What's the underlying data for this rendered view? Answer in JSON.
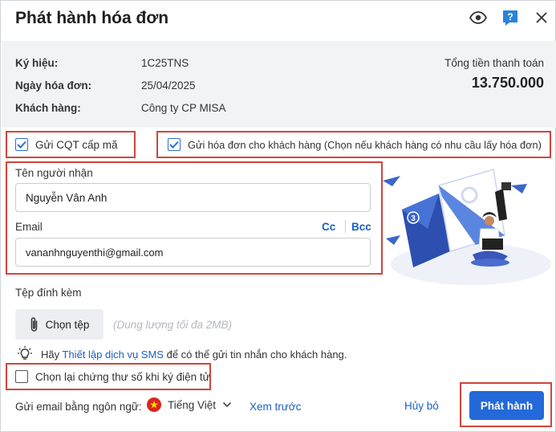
{
  "dialog": {
    "title": "Phát hành hóa đơn"
  },
  "header_icons": [
    "eye-icon",
    "help-icon",
    "close-icon"
  ],
  "help_icon_glyph": "?",
  "summary": {
    "symbol_label": "Ký hiệu:",
    "symbol_value": "1C25TNS",
    "date_label": "Ngày hóa đơn:",
    "date_value": "25/04/2025",
    "customer_label": "Khách hàng:",
    "customer_value": "Công ty CP MISA",
    "total_label": "Tổng tiền thanh toán",
    "total_value": "13.750.000"
  },
  "options": {
    "send_tax_label": "Gửi CQT cấp mã",
    "send_tax_checked": true,
    "send_customer_label": "Gửi hóa đơn cho khách hàng (Chọn nếu khách hàng có nhu cầu lấy hóa đơn)",
    "send_customer_checked": true
  },
  "recipient": {
    "name_label": "Tên người nhận",
    "name_value": "Nguyễn Vân Anh",
    "email_label": "Email",
    "cc_label": "Cc",
    "bcc_label": "Bcc",
    "email_value": "vananhnguyenthi@gmail.com"
  },
  "attachment": {
    "label": "Tệp đính kèm",
    "choose_button": "Chọn tệp",
    "hint": "(Dung lượng tối đa 2MB)"
  },
  "sms_tip": {
    "prefix": "Hãy",
    "link": "Thiết lập dịch vụ SMS",
    "suffix": "để có thể gửi tin nhắn cho khách hàng."
  },
  "reselect_cert": {
    "label": "Chọn lại chứng thư số khi ký điện tử",
    "checked": false
  },
  "footer": {
    "language_label": "Gửi email bằng ngôn ngữ:",
    "language_value": "Tiếng Việt",
    "preview_link": "Xem trước",
    "cancel_button": "Hủy bỏ",
    "submit_button": "Phát hành"
  },
  "illustration_badge": "3",
  "colors": {
    "accent": "#2469d9",
    "link": "#1a5fc5",
    "highlight_box": "#d0453c",
    "summary_bg": "#f2f3f5"
  }
}
